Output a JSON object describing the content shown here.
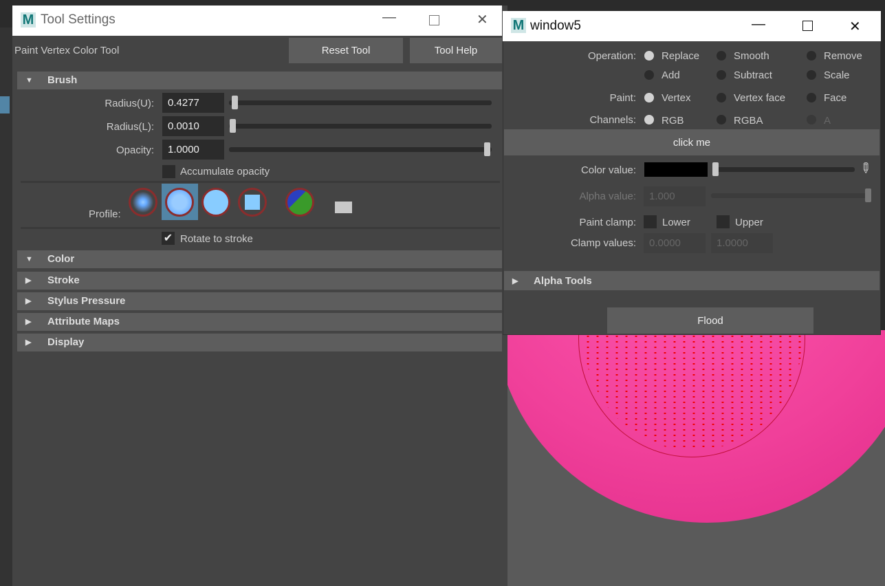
{
  "tool_settings": {
    "title": "Tool Settings",
    "tool_name": "Paint Vertex Color Tool",
    "reset_label": "Reset Tool",
    "help_label": "Tool Help",
    "brush": {
      "header": "Brush",
      "radius_u_label": "Radius(U):",
      "radius_u": "0.4277",
      "radius_l_label": "Radius(L):",
      "radius_l": "0.0010",
      "opacity_label": "Opacity:",
      "opacity": "1.0000",
      "accumulate_label": "Accumulate opacity",
      "accumulate_checked": false,
      "profile_label": "Profile:",
      "rotate_label": "Rotate to stroke",
      "rotate_checked": true
    },
    "sections": [
      "Color",
      "Stroke",
      "Stylus Pressure",
      "Attribute Maps",
      "Display"
    ]
  },
  "window5": {
    "title": "window5",
    "operation_label": "Operation:",
    "operations": [
      "Replace",
      "Smooth",
      "Remove",
      "Add",
      "Subtract",
      "Scale"
    ],
    "operation_selected": "Replace",
    "paint_label": "Paint:",
    "paint_options": [
      "Vertex",
      "Vertex face",
      "Face"
    ],
    "paint_selected": "Vertex",
    "channels_label": "Channels:",
    "channel_options": [
      "RGB",
      "RGBA",
      "A"
    ],
    "channel_selected": "RGB",
    "click_label": "click me",
    "color_label": "Color value:",
    "color_swatch": "#000000",
    "alpha_label": "Alpha value:",
    "alpha_value": "1.000",
    "clamp_label": "Paint clamp:",
    "lower_label": "Lower",
    "upper_label": "Upper",
    "clamp_values_label": "Clamp values:",
    "clamp_lower": "0.0000",
    "clamp_upper": "1.0000",
    "alpha_tools_label": "Alpha Tools",
    "flood_label": "Flood"
  },
  "colors": {
    "sphere": "#f0409a",
    "panel": "#444444",
    "header": "#5d5d5d"
  }
}
